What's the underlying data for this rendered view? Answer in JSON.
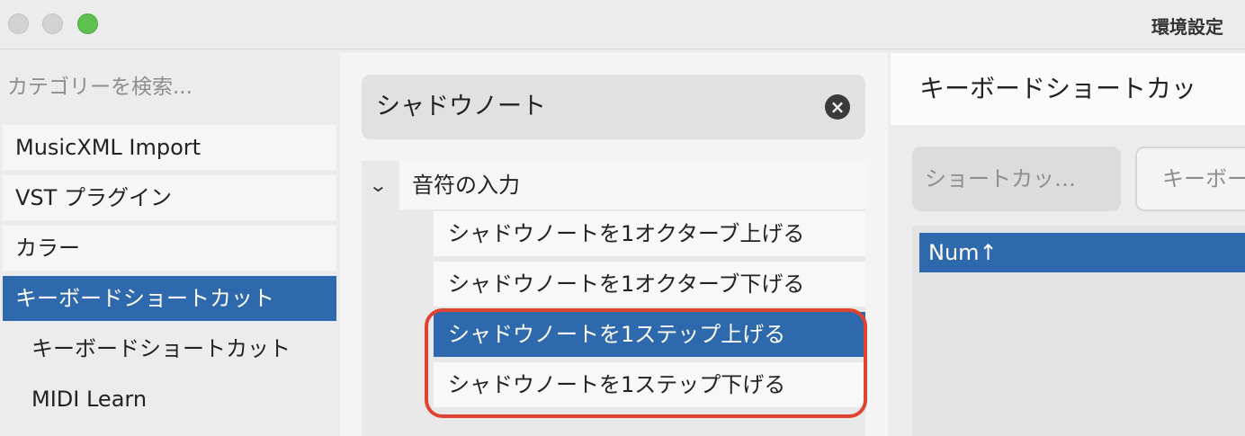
{
  "window": {
    "title": "環境設定"
  },
  "sidebar": {
    "search_placeholder": "カテゴリーを検索...",
    "items": [
      {
        "label": "MusicXML Import"
      },
      {
        "label": "VST プラグイン"
      },
      {
        "label": "カラー"
      },
      {
        "label": "キーボードショートカット",
        "selected": true
      }
    ],
    "subitems": [
      {
        "label": "キーボードショートカット"
      },
      {
        "label": "MIDI Learn"
      }
    ]
  },
  "commands": {
    "search_value": "シャドウノート",
    "group": {
      "label": "音符の入力",
      "expanded": true
    },
    "items": [
      {
        "label": "シャドウノートを1オクターブ上げる"
      },
      {
        "label": "シャドウノートを1オクターブ下げる"
      },
      {
        "label": "シャドウノートを1ステップ上げる",
        "selected": true
      },
      {
        "label": "シャドウノートを1ステップ下げる"
      }
    ]
  },
  "shortcut_panel": {
    "title": "キーボードショートカッ",
    "tab_shortcut": "ショートカッ…",
    "tab_keyboard": "キーボー",
    "shortcuts": [
      {
        "label": "Num↑"
      }
    ]
  },
  "colors": {
    "selection": "#2e68ad",
    "annotation": "#e0432f",
    "traffic_max": "#5dc04f"
  }
}
